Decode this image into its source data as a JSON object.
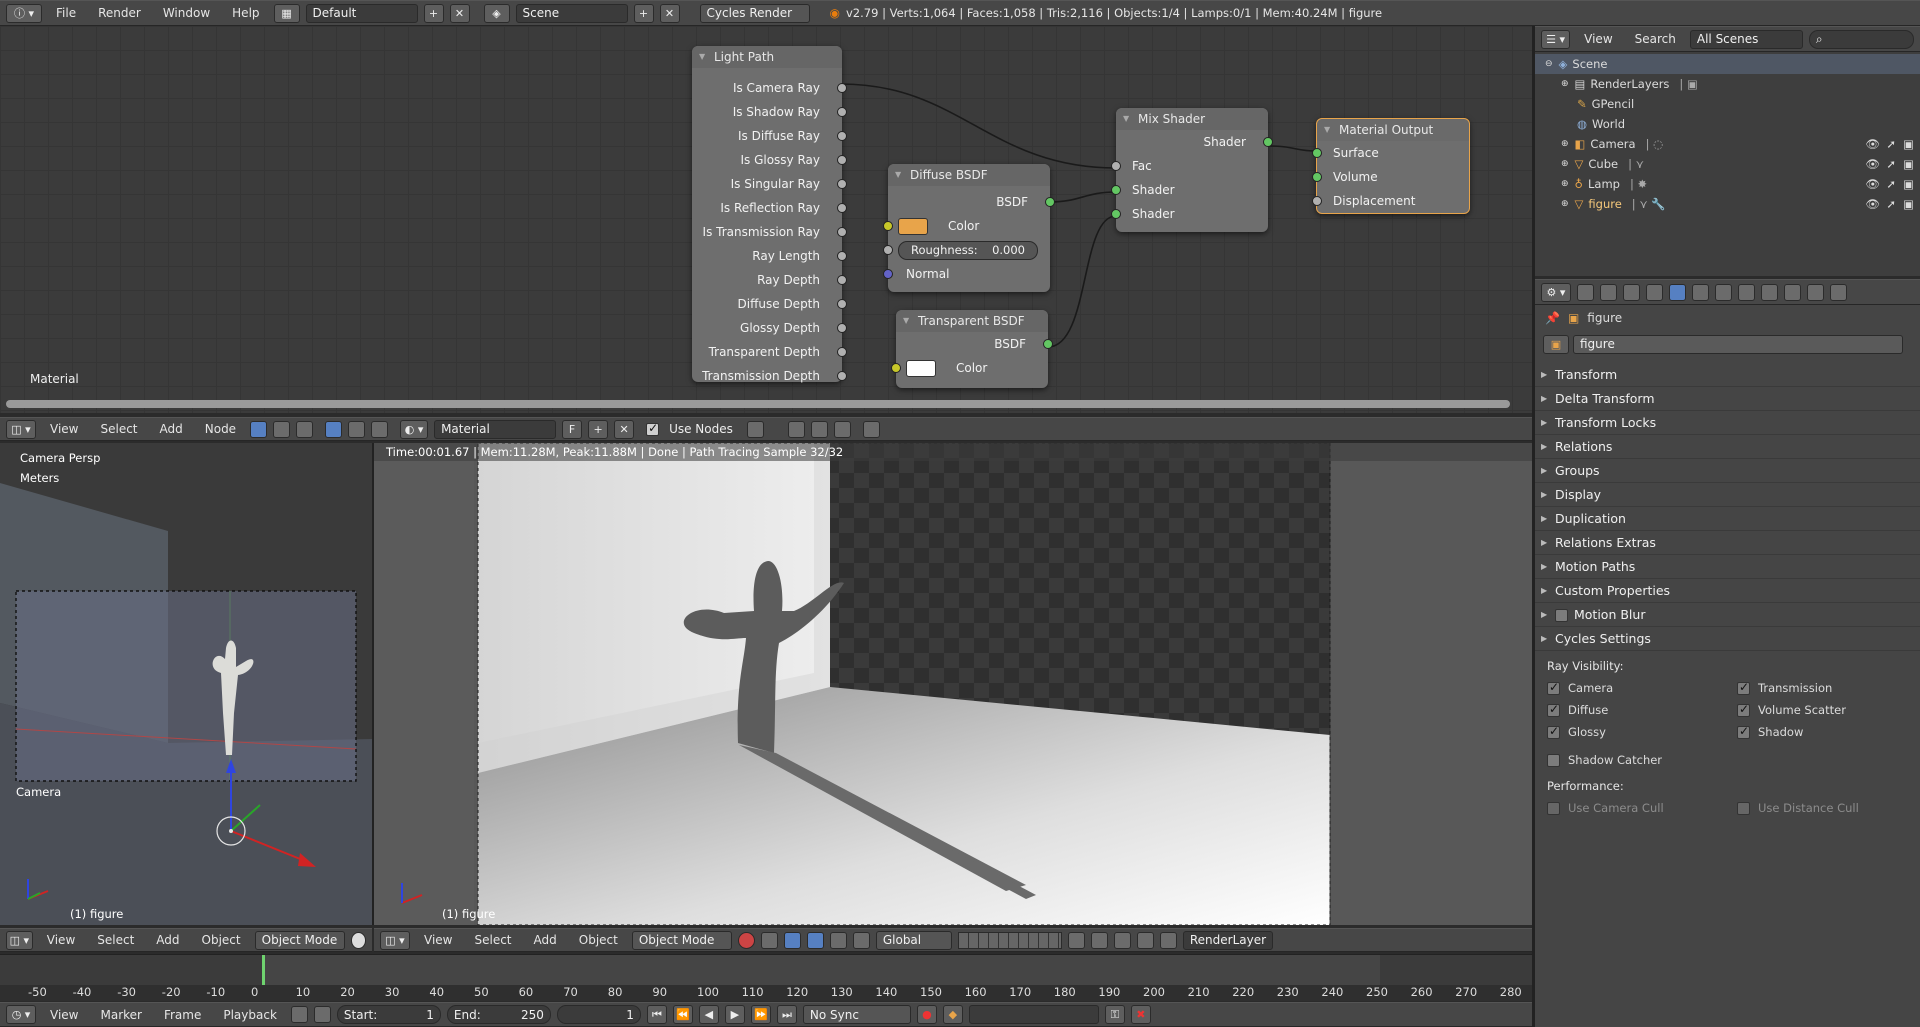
{
  "topbar": {
    "menus": [
      "File",
      "Render",
      "Window",
      "Help"
    ],
    "layout": "Default",
    "scene": "Scene",
    "engine": "Cycles Render",
    "stats": "v2.79 | Verts:1,064 | Faces:1,058 | Tris:2,116 | Objects:1/4 | Lamps:0/1 | Mem:40.24M | figure"
  },
  "node_editor": {
    "corner_label": "Material",
    "nodes": {
      "light_path": {
        "title": "Light Path",
        "outputs": [
          "Is Camera Ray",
          "Is Shadow Ray",
          "Is Diffuse Ray",
          "Is Glossy Ray",
          "Is Singular Ray",
          "Is Reflection Ray",
          "Is Transmission Ray",
          "Ray Length",
          "Ray Depth",
          "Diffuse Depth",
          "Glossy Depth",
          "Transparent Depth",
          "Transmission Depth"
        ]
      },
      "diffuse": {
        "title": "Diffuse BSDF",
        "out": "BSDF",
        "color": "Color",
        "color_swatch": "#e8a44a",
        "roughness_label": "Roughness:",
        "roughness": "0.000",
        "normal": "Normal"
      },
      "transparent": {
        "title": "Transparent BSDF",
        "out": "BSDF",
        "color": "Color",
        "color_swatch": "#ffffff"
      },
      "mix": {
        "title": "Mix Shader",
        "out": "Shader",
        "in1": "Fac",
        "in2": "Shader",
        "in3": "Shader"
      },
      "output": {
        "title": "Material Output",
        "in1": "Surface",
        "in2": "Volume",
        "in3": "Displacement"
      }
    }
  },
  "node_header": {
    "menus": [
      "View",
      "Select",
      "Add",
      "Node"
    ],
    "material": "Material",
    "fake_user": "F",
    "use_nodes": "Use Nodes"
  },
  "viewport_left": {
    "title": "Camera Persp",
    "units": "Meters",
    "camera_label": "Camera",
    "object_label": "(1) figure",
    "menus": [
      "View",
      "Select",
      "Add",
      "Object"
    ],
    "mode": "Object Mode"
  },
  "viewport_render": {
    "status": "Time:00:01.67 | Mem:11.28M, Peak:11.88M | Done | Path Tracing Sample 32/32",
    "object_label": "(1) figure",
    "menus": [
      "View",
      "Select",
      "Add",
      "Object"
    ],
    "mode": "Object Mode",
    "orientation": "Global",
    "render_layer": "RenderLayer"
  },
  "outliner": {
    "menus": [
      "View",
      "Search"
    ],
    "filter": "All Scenes",
    "items": [
      {
        "label": "Scene",
        "icon": "scene-icon"
      },
      {
        "label": "RenderLayers",
        "icon": "renderlayers-icon"
      },
      {
        "label": "GPencil",
        "icon": "gpencil-icon"
      },
      {
        "label": "World",
        "icon": "world-icon"
      },
      {
        "label": "Camera",
        "icon": "camera-icon"
      },
      {
        "label": "Cube",
        "icon": "mesh-icon"
      },
      {
        "label": "Lamp",
        "icon": "lamp-icon"
      },
      {
        "label": "figure",
        "icon": "mesh-icon"
      }
    ]
  },
  "properties": {
    "breadcrumb": "figure",
    "object_name": "figure",
    "panels": [
      "Transform",
      "Delta Transform",
      "Transform Locks",
      "Relations",
      "Groups",
      "Display",
      "Duplication",
      "Relations Extras",
      "Motion Paths",
      "Custom Properties",
      "Motion Blur"
    ],
    "cycles": {
      "title": "Cycles Settings",
      "ray_visibility": "Ray Visibility:",
      "left": [
        "Camera",
        "Diffuse",
        "Glossy"
      ],
      "right": [
        "Transmission",
        "Volume Scatter",
        "Shadow"
      ],
      "shadow_catcher": "Shadow Catcher",
      "performance": "Performance:",
      "camera_cull": "Use Camera Cull",
      "distance_cull": "Use Distance Cull"
    }
  },
  "timeline": {
    "ticks": [
      "-50",
      "-40",
      "-30",
      "-20",
      "-10",
      "0",
      "10",
      "20",
      "30",
      "40",
      "50",
      "60",
      "70",
      "80",
      "90",
      "100",
      "110",
      "120",
      "130",
      "140",
      "150",
      "160",
      "170",
      "180",
      "190",
      "200",
      "210",
      "220",
      "230",
      "240",
      "250",
      "260",
      "270",
      "280"
    ],
    "current_frame": 0,
    "menus": [
      "View",
      "Marker",
      "Frame",
      "Playback"
    ],
    "start_label": "Start:",
    "start": "1",
    "end_label": "End:",
    "end": "250",
    "frame": "1",
    "sync": "No Sync"
  }
}
